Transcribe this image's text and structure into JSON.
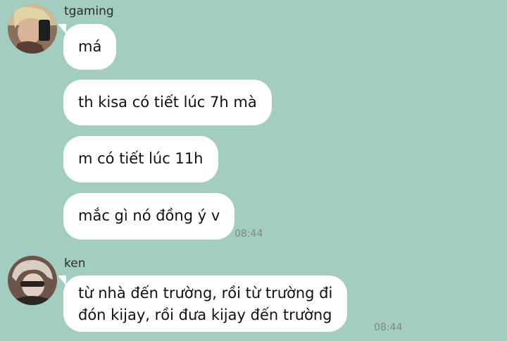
{
  "theme": {
    "background": "#a4cdc1",
    "bubble": "#ffffff",
    "text": "#111111",
    "timestamp": "#7b8a86"
  },
  "groups": [
    {
      "sender": "tgaming",
      "avatar_icon": "user-avatar-icon",
      "messages": [
        {
          "lines": [
            "má"
          ]
        },
        {
          "lines": [
            "th kisa có tiết lúc 7h mà"
          ]
        },
        {
          "lines": [
            "m có tiết lúc 11h"
          ]
        },
        {
          "lines": [
            "mắc gì nó đồng ý v"
          ],
          "time": "08:44"
        }
      ]
    },
    {
      "sender": "ken",
      "avatar_icon": "user-avatar-icon",
      "messages": [
        {
          "lines": [
            "từ nhà đến trường, rồi từ trường đi",
            "đón kijay, rồi đưa kijay đến trường"
          ],
          "time": "08:44"
        }
      ]
    }
  ]
}
